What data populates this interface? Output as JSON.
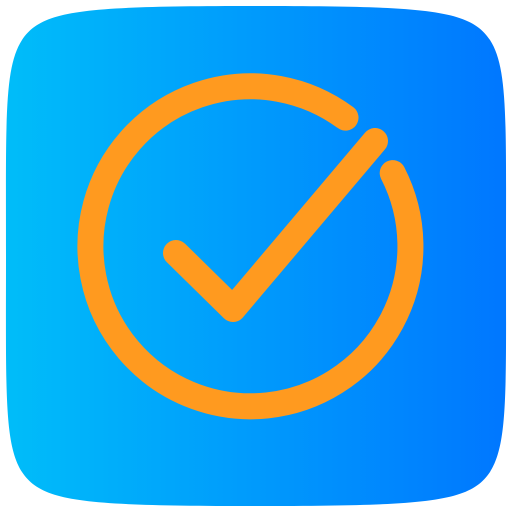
{
  "icon": {
    "name": "check-circle-icon",
    "background_gradient": {
      "from": "#00BDF9",
      "to": "#0077FF",
      "direction": "left-to-right"
    },
    "foreground_color": "#FF9A1F",
    "shape": "squircle",
    "glyph": "checkmark-in-open-circle"
  }
}
